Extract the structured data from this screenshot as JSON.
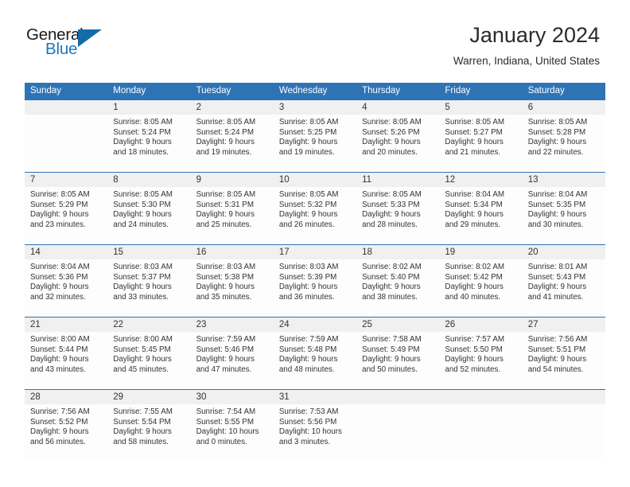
{
  "brand": {
    "logo_primary": "General",
    "logo_secondary": "Blue",
    "triangle_icon": "blue-triangle-icon",
    "accent_color": "#156aa8",
    "blue_text_color": "#1878be"
  },
  "header": {
    "title": "January 2024",
    "subtitle": "Warren, Indiana, United States"
  },
  "calendar": {
    "header_bg": "#2e74b5",
    "daynum_bg": "#f0f0f0",
    "weekdays": [
      "Sunday",
      "Monday",
      "Tuesday",
      "Wednesday",
      "Thursday",
      "Friday",
      "Saturday"
    ],
    "weeks": [
      {
        "days": [
          {
            "num": "",
            "sunrise": "",
            "sunset": "",
            "daylight1": "",
            "daylight2": ""
          },
          {
            "num": "1",
            "sunrise": "Sunrise: 8:05 AM",
            "sunset": "Sunset: 5:24 PM",
            "daylight1": "Daylight: 9 hours",
            "daylight2": "and 18 minutes."
          },
          {
            "num": "2",
            "sunrise": "Sunrise: 8:05 AM",
            "sunset": "Sunset: 5:24 PM",
            "daylight1": "Daylight: 9 hours",
            "daylight2": "and 19 minutes."
          },
          {
            "num": "3",
            "sunrise": "Sunrise: 8:05 AM",
            "sunset": "Sunset: 5:25 PM",
            "daylight1": "Daylight: 9 hours",
            "daylight2": "and 19 minutes."
          },
          {
            "num": "4",
            "sunrise": "Sunrise: 8:05 AM",
            "sunset": "Sunset: 5:26 PM",
            "daylight1": "Daylight: 9 hours",
            "daylight2": "and 20 minutes."
          },
          {
            "num": "5",
            "sunrise": "Sunrise: 8:05 AM",
            "sunset": "Sunset: 5:27 PM",
            "daylight1": "Daylight: 9 hours",
            "daylight2": "and 21 minutes."
          },
          {
            "num": "6",
            "sunrise": "Sunrise: 8:05 AM",
            "sunset": "Sunset: 5:28 PM",
            "daylight1": "Daylight: 9 hours",
            "daylight2": "and 22 minutes."
          }
        ]
      },
      {
        "days": [
          {
            "num": "7",
            "sunrise": "Sunrise: 8:05 AM",
            "sunset": "Sunset: 5:29 PM",
            "daylight1": "Daylight: 9 hours",
            "daylight2": "and 23 minutes."
          },
          {
            "num": "8",
            "sunrise": "Sunrise: 8:05 AM",
            "sunset": "Sunset: 5:30 PM",
            "daylight1": "Daylight: 9 hours",
            "daylight2": "and 24 minutes."
          },
          {
            "num": "9",
            "sunrise": "Sunrise: 8:05 AM",
            "sunset": "Sunset: 5:31 PM",
            "daylight1": "Daylight: 9 hours",
            "daylight2": "and 25 minutes."
          },
          {
            "num": "10",
            "sunrise": "Sunrise: 8:05 AM",
            "sunset": "Sunset: 5:32 PM",
            "daylight1": "Daylight: 9 hours",
            "daylight2": "and 26 minutes."
          },
          {
            "num": "11",
            "sunrise": "Sunrise: 8:05 AM",
            "sunset": "Sunset: 5:33 PM",
            "daylight1": "Daylight: 9 hours",
            "daylight2": "and 28 minutes."
          },
          {
            "num": "12",
            "sunrise": "Sunrise: 8:04 AM",
            "sunset": "Sunset: 5:34 PM",
            "daylight1": "Daylight: 9 hours",
            "daylight2": "and 29 minutes."
          },
          {
            "num": "13",
            "sunrise": "Sunrise: 8:04 AM",
            "sunset": "Sunset: 5:35 PM",
            "daylight1": "Daylight: 9 hours",
            "daylight2": "and 30 minutes."
          }
        ]
      },
      {
        "days": [
          {
            "num": "14",
            "sunrise": "Sunrise: 8:04 AM",
            "sunset": "Sunset: 5:36 PM",
            "daylight1": "Daylight: 9 hours",
            "daylight2": "and 32 minutes."
          },
          {
            "num": "15",
            "sunrise": "Sunrise: 8:03 AM",
            "sunset": "Sunset: 5:37 PM",
            "daylight1": "Daylight: 9 hours",
            "daylight2": "and 33 minutes."
          },
          {
            "num": "16",
            "sunrise": "Sunrise: 8:03 AM",
            "sunset": "Sunset: 5:38 PM",
            "daylight1": "Daylight: 9 hours",
            "daylight2": "and 35 minutes."
          },
          {
            "num": "17",
            "sunrise": "Sunrise: 8:03 AM",
            "sunset": "Sunset: 5:39 PM",
            "daylight1": "Daylight: 9 hours",
            "daylight2": "and 36 minutes."
          },
          {
            "num": "18",
            "sunrise": "Sunrise: 8:02 AM",
            "sunset": "Sunset: 5:40 PM",
            "daylight1": "Daylight: 9 hours",
            "daylight2": "and 38 minutes."
          },
          {
            "num": "19",
            "sunrise": "Sunrise: 8:02 AM",
            "sunset": "Sunset: 5:42 PM",
            "daylight1": "Daylight: 9 hours",
            "daylight2": "and 40 minutes."
          },
          {
            "num": "20",
            "sunrise": "Sunrise: 8:01 AM",
            "sunset": "Sunset: 5:43 PM",
            "daylight1": "Daylight: 9 hours",
            "daylight2": "and 41 minutes."
          }
        ]
      },
      {
        "days": [
          {
            "num": "21",
            "sunrise": "Sunrise: 8:00 AM",
            "sunset": "Sunset: 5:44 PM",
            "daylight1": "Daylight: 9 hours",
            "daylight2": "and 43 minutes."
          },
          {
            "num": "22",
            "sunrise": "Sunrise: 8:00 AM",
            "sunset": "Sunset: 5:45 PM",
            "daylight1": "Daylight: 9 hours",
            "daylight2": "and 45 minutes."
          },
          {
            "num": "23",
            "sunrise": "Sunrise: 7:59 AM",
            "sunset": "Sunset: 5:46 PM",
            "daylight1": "Daylight: 9 hours",
            "daylight2": "and 47 minutes."
          },
          {
            "num": "24",
            "sunrise": "Sunrise: 7:59 AM",
            "sunset": "Sunset: 5:48 PM",
            "daylight1": "Daylight: 9 hours",
            "daylight2": "and 48 minutes."
          },
          {
            "num": "25",
            "sunrise": "Sunrise: 7:58 AM",
            "sunset": "Sunset: 5:49 PM",
            "daylight1": "Daylight: 9 hours",
            "daylight2": "and 50 minutes."
          },
          {
            "num": "26",
            "sunrise": "Sunrise: 7:57 AM",
            "sunset": "Sunset: 5:50 PM",
            "daylight1": "Daylight: 9 hours",
            "daylight2": "and 52 minutes."
          },
          {
            "num": "27",
            "sunrise": "Sunrise: 7:56 AM",
            "sunset": "Sunset: 5:51 PM",
            "daylight1": "Daylight: 9 hours",
            "daylight2": "and 54 minutes."
          }
        ]
      },
      {
        "days": [
          {
            "num": "28",
            "sunrise": "Sunrise: 7:56 AM",
            "sunset": "Sunset: 5:52 PM",
            "daylight1": "Daylight: 9 hours",
            "daylight2": "and 56 minutes."
          },
          {
            "num": "29",
            "sunrise": "Sunrise: 7:55 AM",
            "sunset": "Sunset: 5:54 PM",
            "daylight1": "Daylight: 9 hours",
            "daylight2": "and 58 minutes."
          },
          {
            "num": "30",
            "sunrise": "Sunrise: 7:54 AM",
            "sunset": "Sunset: 5:55 PM",
            "daylight1": "Daylight: 10 hours",
            "daylight2": "and 0 minutes."
          },
          {
            "num": "31",
            "sunrise": "Sunrise: 7:53 AM",
            "sunset": "Sunset: 5:56 PM",
            "daylight1": "Daylight: 10 hours",
            "daylight2": "and 3 minutes."
          },
          {
            "num": "",
            "sunrise": "",
            "sunset": "",
            "daylight1": "",
            "daylight2": ""
          },
          {
            "num": "",
            "sunrise": "",
            "sunset": "",
            "daylight1": "",
            "daylight2": ""
          },
          {
            "num": "",
            "sunrise": "",
            "sunset": "",
            "daylight1": "",
            "daylight2": ""
          }
        ]
      }
    ]
  }
}
